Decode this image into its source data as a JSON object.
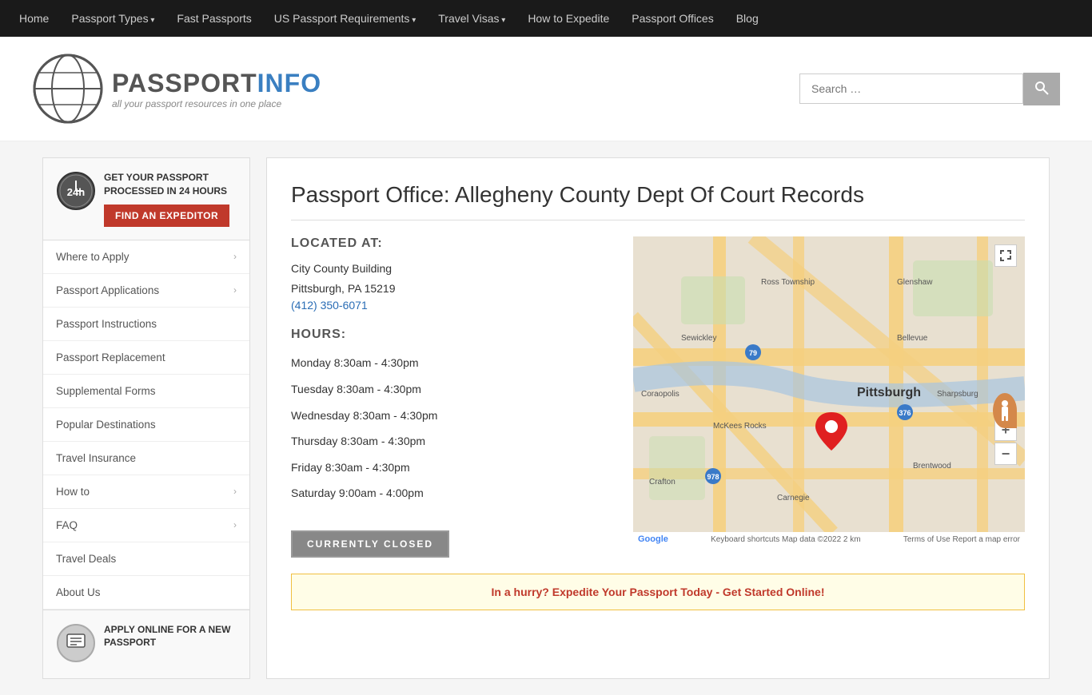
{
  "nav": {
    "items": [
      {
        "label": "Home",
        "dropdown": false
      },
      {
        "label": "Passport Types",
        "dropdown": true
      },
      {
        "label": "Fast Passports",
        "dropdown": false
      },
      {
        "label": "US Passport Requirements",
        "dropdown": true
      },
      {
        "label": "Travel Visas",
        "dropdown": true
      },
      {
        "label": "How to Expedite",
        "dropdown": false
      },
      {
        "label": "Passport Offices",
        "dropdown": false
      },
      {
        "label": "Blog",
        "dropdown": false
      }
    ]
  },
  "header": {
    "logo_title_plain": "PASSPORT",
    "logo_title_accent": "INFO",
    "logo_subtitle": "all your passport resources in one place",
    "search_placeholder": "Search …"
  },
  "sidebar": {
    "promo": {
      "icon_label": "24h",
      "text": "GET YOUR PASSPORT PROCESSED IN 24 HOURS",
      "button_label": "FIND AN EXPEDITOR"
    },
    "menu_items": [
      {
        "label": "Where to Apply",
        "dropdown": true
      },
      {
        "label": "Passport Applications",
        "dropdown": true
      },
      {
        "label": "Passport Instructions",
        "dropdown": false
      },
      {
        "label": "Passport Replacement",
        "dropdown": false
      },
      {
        "label": "Supplemental Forms",
        "dropdown": false
      },
      {
        "label": "Popular Destinations",
        "dropdown": false
      },
      {
        "label": "Travel Insurance",
        "dropdown": false
      },
      {
        "label": "How to",
        "dropdown": true
      },
      {
        "label": "FAQ",
        "dropdown": true
      },
      {
        "label": "Travel Deals",
        "dropdown": false
      },
      {
        "label": "About Us",
        "dropdown": false
      }
    ],
    "bottom_promo": {
      "text": "APPLY ONLINE FOR A NEW PASSPORT"
    }
  },
  "main": {
    "page_title": "Passport Office: Allegheny County Dept Of Court Records",
    "located_label": "LOCATED AT:",
    "address_line1": "City County Building",
    "address_line2": "Pittsburgh, PA 15219",
    "phone": "(412) 350-6071",
    "hours_label": "HOURS:",
    "hours": [
      {
        "day": "Monday",
        "time": "8:30am - 4:30pm"
      },
      {
        "day": "Tuesday",
        "time": "8:30am - 4:30pm"
      },
      {
        "day": "Wednesday",
        "time": "8:30am - 4:30pm"
      },
      {
        "day": "Thursday",
        "time": "8:30am - 4:30pm"
      },
      {
        "day": "Friday",
        "time": "8:30am - 4:30pm"
      },
      {
        "day": "Saturday",
        "time": "9:00am - 4:00pm"
      }
    ],
    "status": "CURRENTLY CLOSED",
    "map_footer_left": "Google",
    "map_footer_center": "Keyboard shortcuts    Map data ©2022    2 km",
    "map_footer_right": "Terms of Use    Report a map error",
    "promo_banner": "In a hurry? Expedite Your Passport Today - Get Started Online!"
  }
}
